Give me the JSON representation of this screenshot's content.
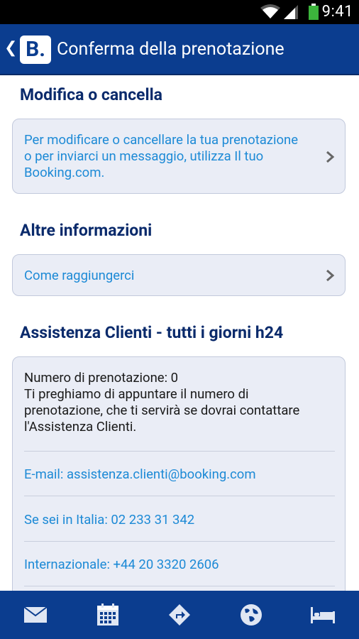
{
  "status_bar": {
    "time": "9:41"
  },
  "header": {
    "logo_text": "B.",
    "title": "Conferma della prenotazione"
  },
  "sections": {
    "modify": {
      "heading": "Modifica o cancella",
      "card_lines": [
        "Per modificare o cancellare la tua prenotazione",
        "o per inviarci un messaggio, utilizza Il tuo",
        "Booking.com."
      ]
    },
    "other_info": {
      "heading": "Altre informazioni",
      "link": "Come raggiungerci"
    },
    "support": {
      "heading": "Assistenza Clienti - tutti i giorni h24",
      "booking_number": "Numero di prenotazione: 0",
      "note_lines": [
        "Ti preghiamo di appuntare il numero di",
        "prenotazione, che ti servirà se dovrai contattare",
        "l'Assistenza Clienti."
      ],
      "email": "E-mail: assistenza.clienti@booking.com",
      "italy_phone": "Se sei in Italia: 02 233 31 342",
      "intl_phone": "Internazionale: +44 20 3320 2606"
    }
  },
  "bottom_nav": {
    "items": [
      "mail-icon",
      "calendar-icon",
      "directions-icon",
      "globe-icon",
      "bed-icon"
    ]
  },
  "colors": {
    "brand": "#0b3d8f",
    "link": "#1d8ad6",
    "heading": "#0a2a6b",
    "card_bg": "#eaedf6"
  }
}
